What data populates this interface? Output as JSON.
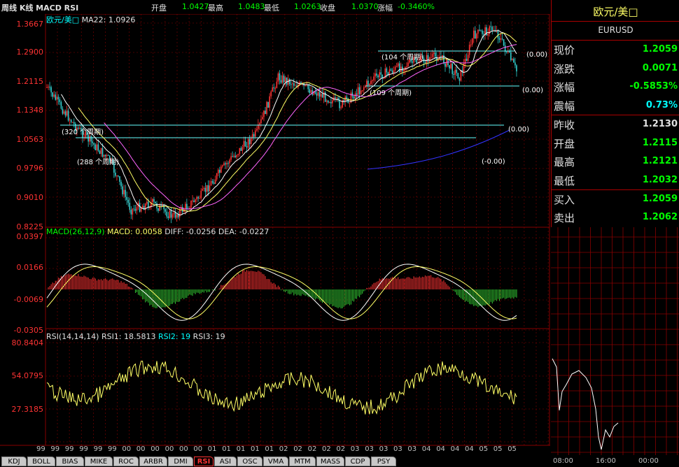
{
  "header": {
    "title": "周线 K线 MACD RSI",
    "open_label": "开盘",
    "open_value": "1.0427",
    "high_label": "最高",
    "high_value": "1.0483",
    "low_label": "最低",
    "low_value": "1.0263",
    "close_label": "收盘",
    "close_value": "1.0370",
    "change_label": "涨幅",
    "change_value": "-0.3460%"
  },
  "main_chart": {
    "legend_symbol": "欧元/美□",
    "legend_ma": "MA22: 1.0926",
    "y_ticks": [
      "1.3667",
      "1.2900",
      "1.2115",
      "1.1348",
      "1.0563",
      "0.9796",
      "0.9010",
      "0.8225"
    ],
    "period_labels": [
      "(104 个周期)",
      "(109 个周期)",
      "(320 个周期)",
      "(288 个周期)"
    ],
    "level_values": [
      "(0.00)",
      "(0.00)",
      "(0.00)",
      "(-0.00)"
    ]
  },
  "macd_panel": {
    "legend_title": "MACD(26,12,9)",
    "legend_macd": "MACD: 0.0058",
    "legend_diff": "DIFF: -0.0256",
    "legend_dea": "DEA: -0.0227",
    "y_ticks": [
      "0.0397",
      "0.0166",
      "-0.0069",
      "-0.0305"
    ]
  },
  "rsi_panel": {
    "legend_title": "RSI(14,14,14)",
    "legend_rsi1": "RSI1: 18.5813",
    "legend_rsi2": "RSI2: 19",
    "legend_rsi3": "RSI3: 19",
    "y_ticks": [
      "80.8404",
      "54.0795",
      "27.3185"
    ]
  },
  "x_axis_labels": [
    "99",
    "99",
    "99",
    "99",
    "99",
    "99",
    "00",
    "00",
    "00",
    "00",
    "00",
    "00",
    "01",
    "01",
    "01",
    "01",
    "01",
    "02",
    "02",
    "02",
    "02",
    "02",
    "03",
    "03",
    "03",
    "03",
    "03",
    "04",
    "04",
    "04",
    "04",
    "05",
    "05",
    "05"
  ],
  "quote": {
    "name": "欧元/美□",
    "code": "EURUSD",
    "rows": [
      {
        "label": "现价",
        "value": "1.2059",
        "color": "#00ff00"
      },
      {
        "label": "涨跌",
        "value": "0.0071",
        "color": "#00ff00"
      },
      {
        "label": "涨幅",
        "value": "-0.5853%",
        "color": "#00ff00"
      },
      {
        "label": "震幅",
        "value": "0.73%",
        "color": "#00ffff"
      },
      {
        "label": "昨收",
        "value": "1.2130",
        "color": "#e0e0e0"
      },
      {
        "label": "开盘",
        "value": "1.2115",
        "color": "#00ff00"
      },
      {
        "label": "最高",
        "value": "1.2121",
        "color": "#00ff00"
      },
      {
        "label": "最低",
        "value": "1.2032",
        "color": "#00ff00"
      },
      {
        "label": "买入",
        "value": "1.2059",
        "color": "#00ff00"
      },
      {
        "label": "卖出",
        "value": "1.2062",
        "color": "#00ff00"
      }
    ]
  },
  "mini_chart": {
    "x_labels": [
      "08:00",
      "16:00",
      "00:00"
    ]
  },
  "tabs": [
    "KDJ",
    "BOLL",
    "BIAS",
    "MIKE",
    "ROC",
    "ARBR",
    "DMI",
    "RSI",
    "ASI",
    "OSC",
    "VMA",
    "MTM",
    "MASS",
    "CDP",
    "PSY"
  ],
  "active_tab": "RSI",
  "colors": {
    "background": "#000000",
    "grid": "#880000",
    "up_candle": "#ff3333",
    "down_candle": "#33cccc",
    "level_line": "#66ffff",
    "ma_fast": "#ffffff",
    "ma_mid": "#ffff66",
    "ma_slow": "#ff66ff",
    "ma_long": "#3333ff"
  }
}
